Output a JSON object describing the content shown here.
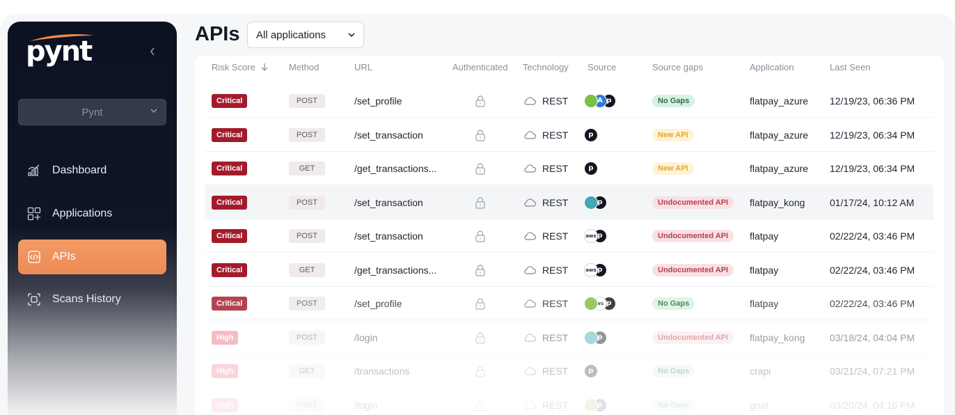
{
  "sidebar": {
    "logo_text": "pynt",
    "workspace": "Pynt",
    "items": [
      {
        "label": "Dashboard",
        "icon": "chart-bar-icon",
        "active": false
      },
      {
        "label": "Applications",
        "icon": "grid-plus-icon",
        "active": false
      },
      {
        "label": "APIs",
        "icon": "code-icon",
        "active": true
      },
      {
        "label": "Scans History",
        "icon": "scan-icon",
        "active": false
      }
    ]
  },
  "header": {
    "title": "APIs",
    "app_filter": "All applications"
  },
  "table": {
    "columns": [
      "Risk Score",
      "Method",
      "URL",
      "Authenticated",
      "Technology",
      "Source",
      "Source gaps",
      "Application",
      "Last Seen"
    ],
    "rows": [
      {
        "risk": "Critical",
        "method": "POST",
        "url": "/set_profile",
        "tech": "REST",
        "sources": [
          "globe-icon",
          "azure-icon",
          "pynt-icon"
        ],
        "gap": "No Gaps",
        "app": "flatpay_azure",
        "seen": "12/19/23, 06:36 PM"
      },
      {
        "risk": "Critical",
        "method": "POST",
        "url": "/set_transaction",
        "tech": "REST",
        "sources": [
          "pynt-icon"
        ],
        "gap": "New API",
        "app": "flatpay_azure",
        "seen": "12/19/23, 06:34 PM"
      },
      {
        "risk": "Critical",
        "method": "GET",
        "url": "/get_transactions...",
        "tech": "REST",
        "sources": [
          "pynt-icon"
        ],
        "gap": "New API",
        "app": "flatpay_azure",
        "seen": "12/19/23, 06:34 PM"
      },
      {
        "risk": "Critical",
        "method": "POST",
        "url": "/set_transaction",
        "tech": "REST",
        "sources": [
          "kong-icon",
          "pynt-icon"
        ],
        "gap": "Undocumented API",
        "app": "flatpay_kong",
        "seen": "01/17/24, 10:12 AM"
      },
      {
        "risk": "Critical",
        "method": "POST",
        "url": "/set_transaction",
        "tech": "REST",
        "sources": [
          "aws-icon",
          "pynt-icon"
        ],
        "gap": "Undocumented API",
        "app": "flatpay",
        "seen": "02/22/24, 03:46 PM"
      },
      {
        "risk": "Critical",
        "method": "GET",
        "url": "/get_transactions...",
        "tech": "REST",
        "sources": [
          "aws-icon",
          "pynt-icon"
        ],
        "gap": "Undocumented API",
        "app": "flatpay",
        "seen": "02/22/24, 03:46 PM"
      },
      {
        "risk": "Critical",
        "method": "POST",
        "url": "/set_profile",
        "tech": "REST",
        "sources": [
          "globe-icon",
          "ws-icon",
          "pynt-icon"
        ],
        "gap": "No Gaps",
        "app": "flatpay",
        "seen": "02/22/24, 03:46 PM"
      },
      {
        "risk": "High",
        "method": "POST",
        "url": "/login",
        "tech": "REST",
        "sources": [
          "kong-icon",
          "pynt-icon"
        ],
        "gap": "Undocumented API",
        "app": "flatpay_kong",
        "seen": "03/18/24, 04:04 PM"
      },
      {
        "risk": "High",
        "method": "GET",
        "url": "/transactions",
        "tech": "REST",
        "sources": [
          "pynt-icon"
        ],
        "gap": "No Gaps",
        "app": "crapi",
        "seen": "03/21/24, 07:21 PM"
      },
      {
        "risk": "High",
        "method": "POST",
        "url": "/login",
        "tech": "REST",
        "sources": [
          "globe-icon",
          "pynt-icon"
        ],
        "gap": "No Gaps",
        "app": "goat",
        "seen": "03/20/24, 04:16 PM"
      }
    ]
  },
  "colors": {
    "sidebar_bg": "#0c1222",
    "accent": "#ee8a55",
    "critical": "#a31b2b",
    "high": "#ea6d7f"
  }
}
